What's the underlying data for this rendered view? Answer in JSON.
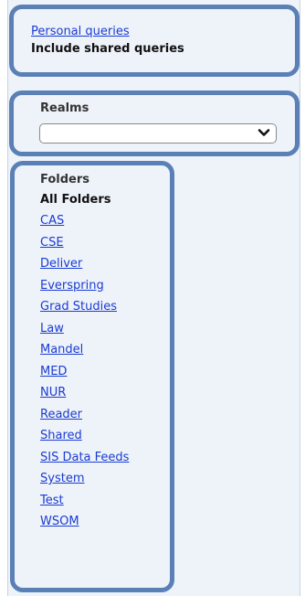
{
  "queries": {
    "personal_link": "Personal queries",
    "shared_label": "Include shared queries"
  },
  "realms": {
    "heading": "Realms",
    "selected_value": ""
  },
  "folders": {
    "heading": "Folders",
    "all_label": "All Folders",
    "items": [
      "CAS",
      "CSE",
      "Deliver",
      "Everspring",
      "Grad Studies",
      "Law",
      "Mandel",
      "MED",
      "NUR",
      "Reader",
      "Shared",
      "SIS Data Feeds",
      "System",
      "Test",
      "WSOM"
    ]
  },
  "colors": {
    "panel_background": "#eef3fa",
    "highlight_border": "#5b80b5",
    "link": "#1a3bd1"
  }
}
